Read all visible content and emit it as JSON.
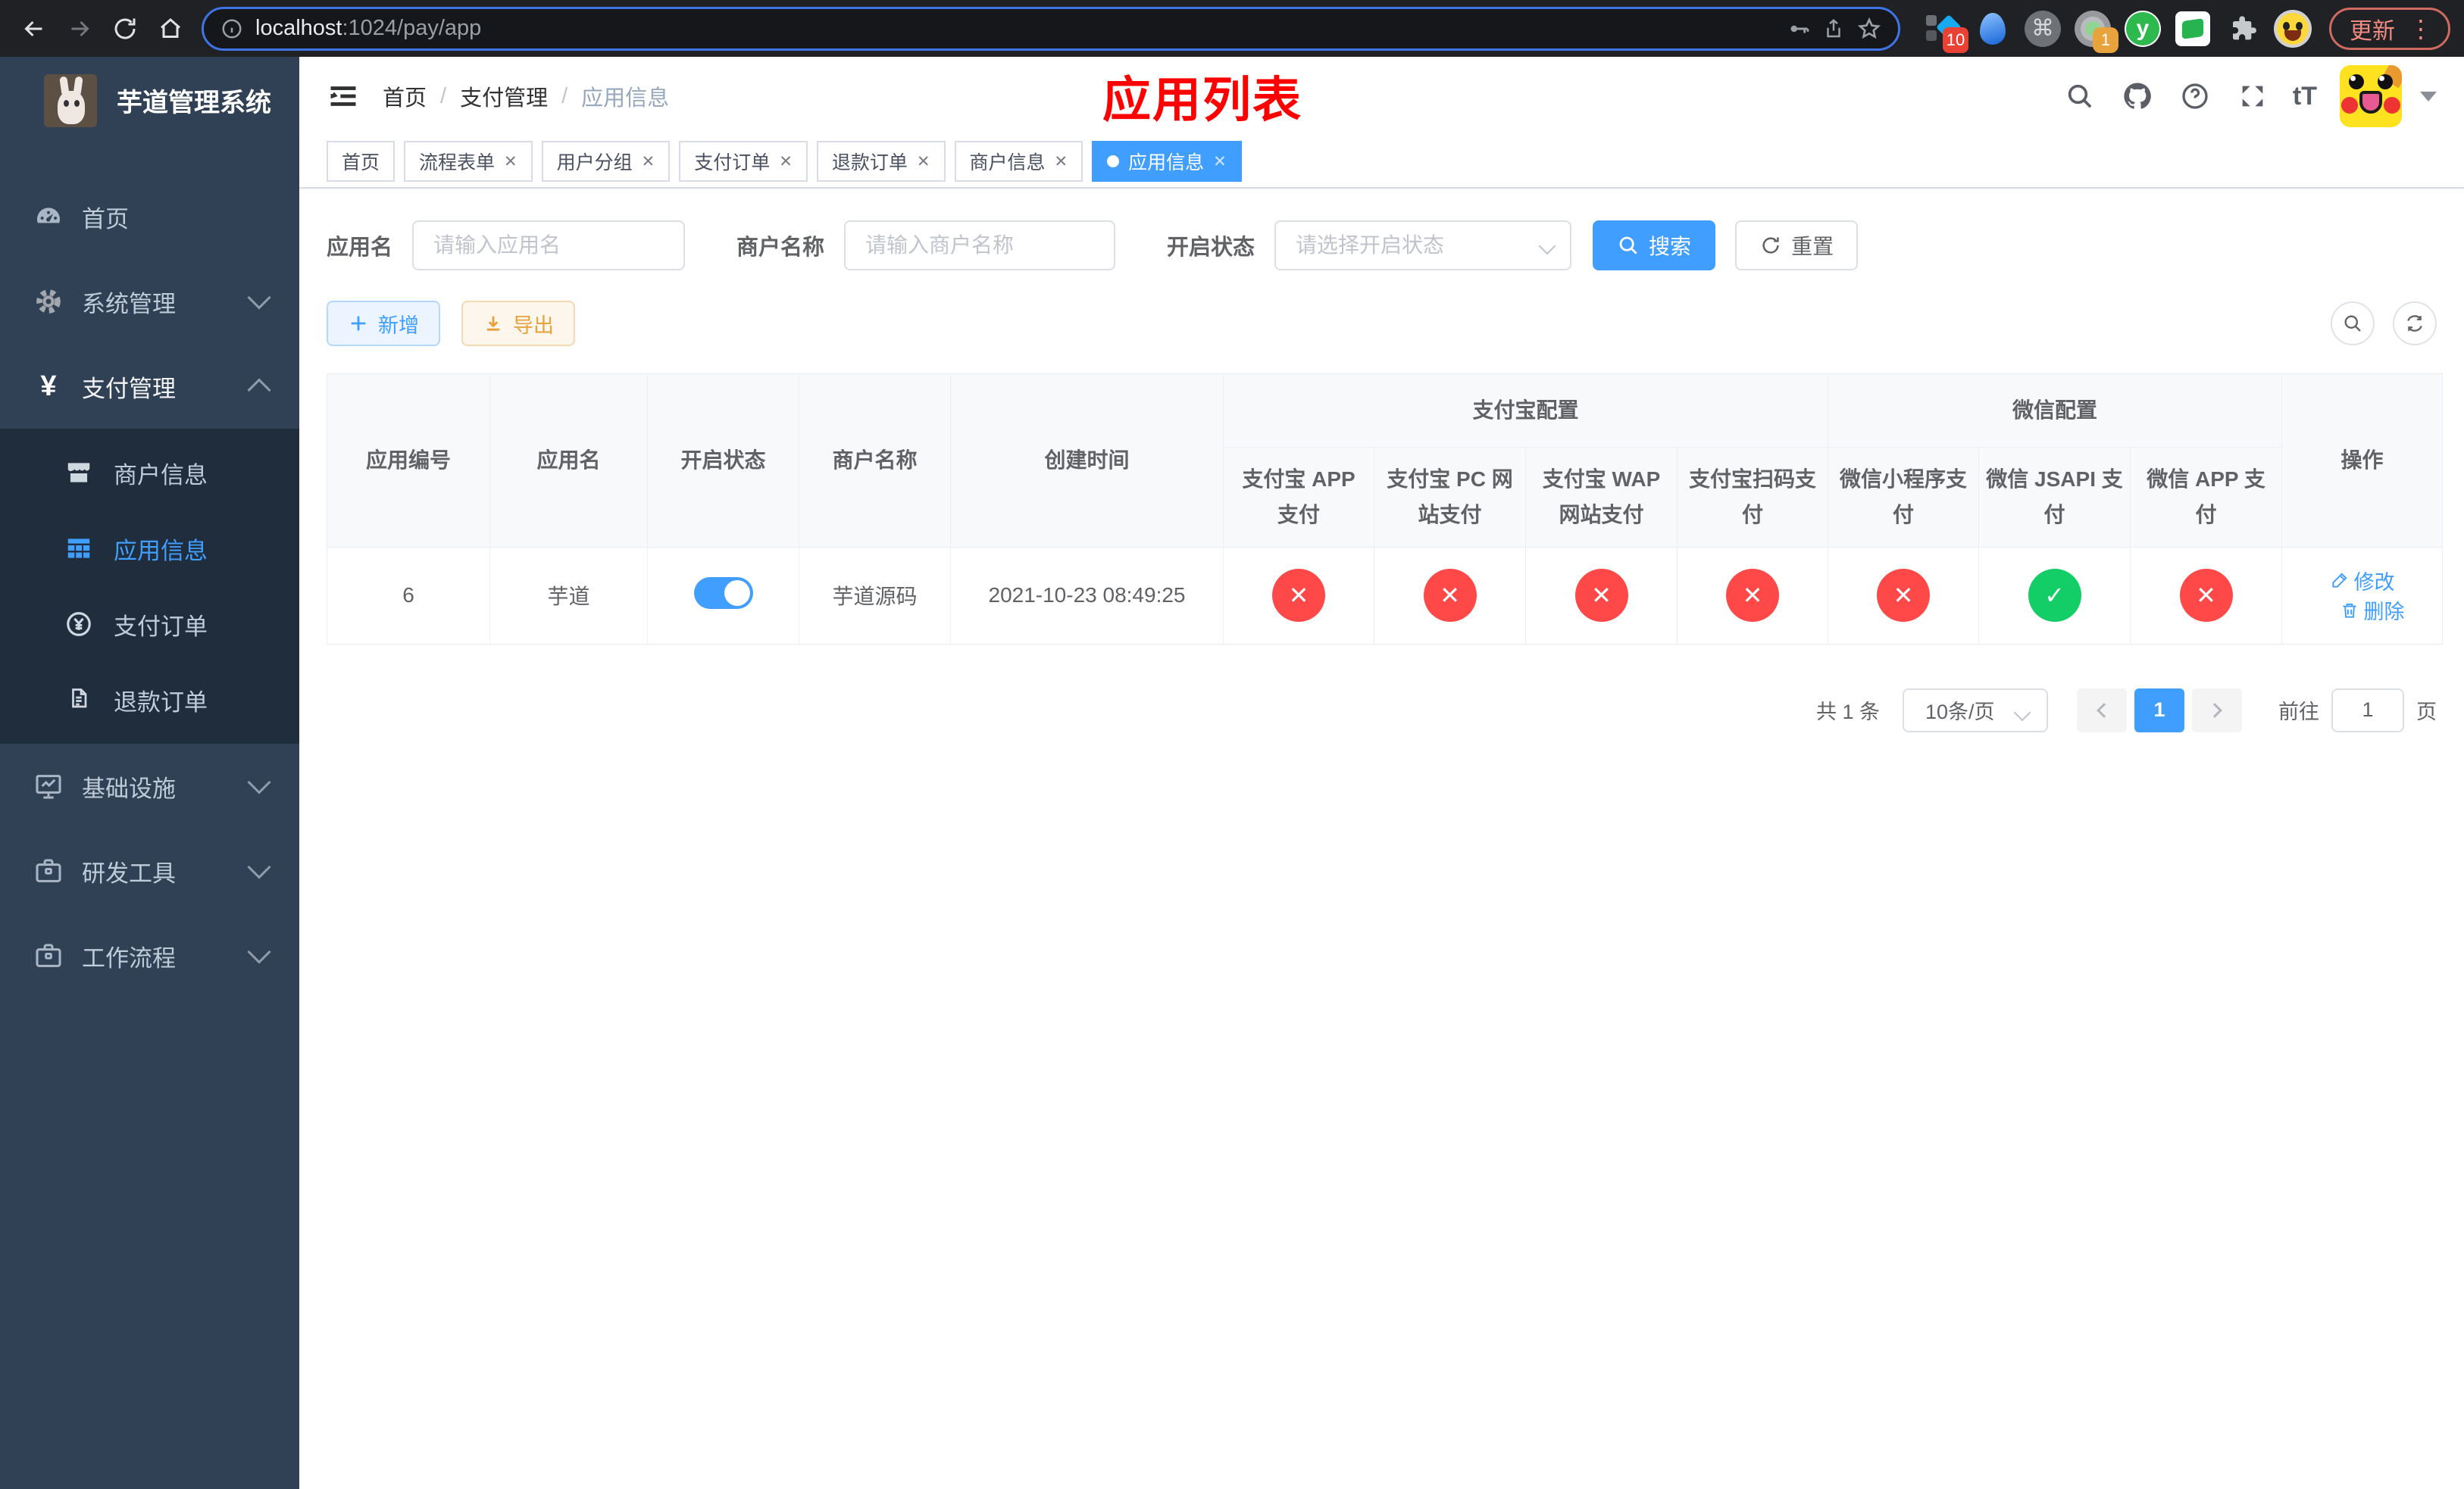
{
  "icons": {
    "close": "✕",
    "check": "✓",
    "yen": "¥",
    "yen_small": "¥",
    "command": "⌘",
    "kebab": "⋮",
    "question": "?",
    "font_size": "tT",
    "ext_y": "y"
  },
  "browser": {
    "url_host": "localhost",
    "url_path": ":1024/pay/app",
    "ext_badge_diamond": "10",
    "ext_badge_loom": "1",
    "update_label": "更新"
  },
  "sidebar": {
    "title": "芋道管理系统",
    "items": [
      {
        "label": "首页",
        "icon": "dashboard-icon"
      },
      {
        "label": "系统管理",
        "icon": "gear-icon"
      },
      {
        "label": "支付管理",
        "icon": "yen-icon"
      },
      {
        "label": "商户信息",
        "icon": "store-icon"
      },
      {
        "label": "应用信息",
        "icon": "grid-icon"
      },
      {
        "label": "支付订单",
        "icon": "yen-circle-icon"
      },
      {
        "label": "退款订单",
        "icon": "document-icon"
      },
      {
        "label": "基础设施",
        "icon": "monitor-icon"
      },
      {
        "label": "研发工具",
        "icon": "briefcase-icon"
      },
      {
        "label": "工作流程",
        "icon": "briefcase-icon"
      }
    ]
  },
  "header": {
    "separator": "/",
    "breadcrumb": [
      "首页",
      "支付管理",
      "应用信息"
    ],
    "annotation": "应用列表"
  },
  "tabs": [
    {
      "label": "首页",
      "closable": false,
      "active": false
    },
    {
      "label": "流程表单",
      "closable": true,
      "active": false
    },
    {
      "label": "用户分组",
      "closable": true,
      "active": false
    },
    {
      "label": "支付订单",
      "closable": true,
      "active": false
    },
    {
      "label": "退款订单",
      "closable": true,
      "active": false
    },
    {
      "label": "商户信息",
      "closable": true,
      "active": false
    },
    {
      "label": "应用信息",
      "closable": true,
      "active": true
    }
  ],
  "filters": {
    "app_name_label": "应用名",
    "app_name_placeholder": "请输入应用名",
    "merchant_label": "商户名称",
    "merchant_placeholder": "请输入商户名称",
    "status_label": "开启状态",
    "status_placeholder": "请选择开启状态",
    "search_label": "搜索",
    "reset_label": "重置"
  },
  "toolbar": {
    "add_label": "新增",
    "export_label": "导出"
  },
  "table": {
    "group_alipay": "支付宝配置",
    "group_wechat": "微信配置",
    "col_id": "应用编号",
    "col_name": "应用名",
    "col_status": "开启状态",
    "col_merchant": "商户名称",
    "col_created": "创建时间",
    "col_alipay_app": "支付宝 APP 支付",
    "col_alipay_pc": "支付宝 PC 网站支付",
    "col_alipay_wap": "支付宝 WAP 网站支付",
    "col_alipay_qr": "支付宝扫码支付",
    "col_wx_mini": "微信小程序支付",
    "col_wx_jsapi": "微信 JSAPI 支付",
    "col_wx_app": "微信 APP 支付",
    "col_actions": "操作",
    "row": {
      "id": "6",
      "name": "芋道",
      "enabled": true,
      "merchant": "芋道源码",
      "created": "2021-10-23 08:49:25",
      "pay_statuses": [
        false,
        false,
        false,
        false,
        false,
        true,
        false
      ],
      "edit_label": "修改",
      "delete_label": "删除"
    }
  },
  "pagination": {
    "total": "共 1 条",
    "page_size": "10条/页",
    "page": "1",
    "goto_prefix": "前往",
    "goto_value": "1",
    "goto_suffix": "页"
  },
  "colors": {
    "accent": "#409eff",
    "sidebar_bg": "#304156",
    "submenu_bg": "#1f2d3d",
    "status_fail": "#ff4949",
    "status_ok": "#13ce66",
    "annotation_red": "#fe0000",
    "warning": "#e6a23c"
  }
}
